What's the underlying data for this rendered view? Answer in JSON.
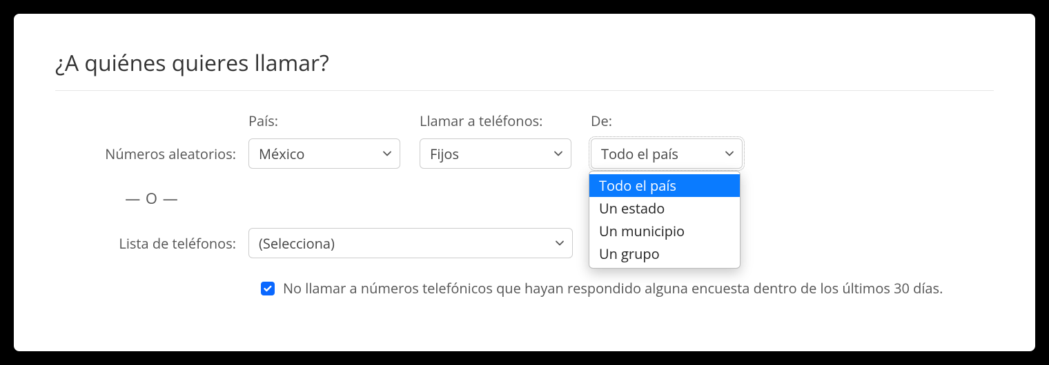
{
  "heading": "¿A quiénes quieres llamar?",
  "random_numbers": {
    "row_label": "Números aleatorios:",
    "country": {
      "label": "País:",
      "value": "México"
    },
    "phone_type": {
      "label": "Llamar a teléfonos:",
      "value": "Fijos"
    },
    "scope": {
      "label": "De:",
      "value": "Todo el país",
      "options": [
        "Todo el país",
        "Un estado",
        "Un municipio",
        "Un grupo"
      ]
    }
  },
  "or_label": "— O —",
  "phone_list": {
    "row_label": "Lista de teléfonos:",
    "value": "(Selecciona)"
  },
  "exclude_checkbox": {
    "checked": true,
    "label": "No llamar a números telefónicos que hayan respondido alguna encuesta dentro de los últimos 30 días."
  }
}
